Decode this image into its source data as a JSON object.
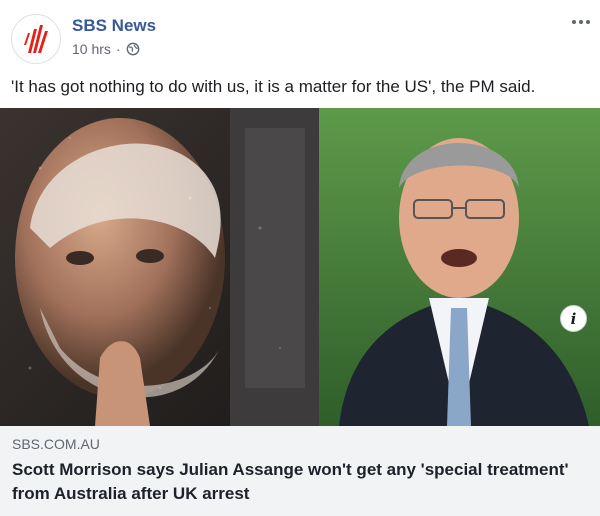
{
  "post": {
    "page_name": "SBS News",
    "timestamp": "10 hrs",
    "separator": "·",
    "privacy_icon": "globe-icon",
    "more_icon": "more-options-icon",
    "caption": "'It has got nothing to do with us, it is a matter for the US', the PM said."
  },
  "link_preview": {
    "domain": "SBS.COM.AU",
    "title": "Scott Morrison says Julian Assange won't get any 'special treatment' from Australia after UK arrest",
    "info_glyph": "i"
  },
  "colors": {
    "page_name": "#385898",
    "brand_red": "#e2231a",
    "link_box_bg": "#f2f3f5"
  }
}
